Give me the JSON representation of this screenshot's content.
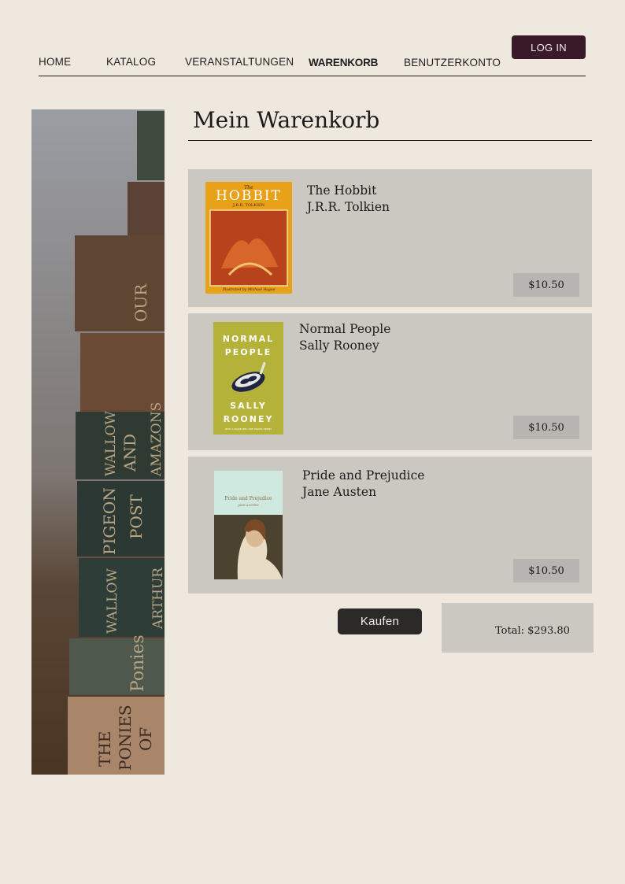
{
  "nav": {
    "items": [
      {
        "label": "HOME",
        "active": false
      },
      {
        "label": "KATALOG",
        "active": false
      },
      {
        "label": "VERANSTALTUNGEN",
        "active": false
      },
      {
        "label": "WARENKORB",
        "active": true
      },
      {
        "label": "BENUTZERKONTO",
        "active": false
      }
    ],
    "login_label": "LOG IN"
  },
  "side_image": {
    "spine_texts": [
      "OUR",
      "AND",
      "AMAZONS",
      "WALLOW",
      "PIGEON",
      "POST",
      "ARTHUR",
      "WALLOW",
      "Ponies",
      "THE",
      "PONIES",
      "OF"
    ]
  },
  "page": {
    "title": "Mein Warenkorb"
  },
  "cart": {
    "items": [
      {
        "title": "The Hobbit",
        "author": "J.R.R. Tolkien",
        "price": "$10.50",
        "cover": {
          "top_label": "The",
          "title": "HOBBIT",
          "author": "J.R.R. TOLKIEN",
          "footer": "Illustrated by Michael Hague"
        }
      },
      {
        "title": "Normal People",
        "author": "Sally Rooney",
        "price": "$10.50",
        "cover": {
          "line1": "NORMAL",
          "line2": "PEOPLE",
          "line3": "SALLY",
          "line4": "ROONEY",
          "footer": "NOW A MAJOR BBC ONE DRAMA SERIES"
        }
      },
      {
        "title": "Pride and Prejudice",
        "author": "Jane Austen",
        "price": "$10.50",
        "cover": {
          "title": "Pride and Prejudice",
          "author": "JANE AUSTEN"
        }
      }
    ],
    "buy_label": "Kaufen",
    "total_label": "Total: $293.80"
  },
  "colors": {
    "background": "#eee8df",
    "login_button": "#3a1a28",
    "buy_button": "#2b2a28",
    "card": "#cbc8c2",
    "price_chip": "#b7b5b1"
  }
}
